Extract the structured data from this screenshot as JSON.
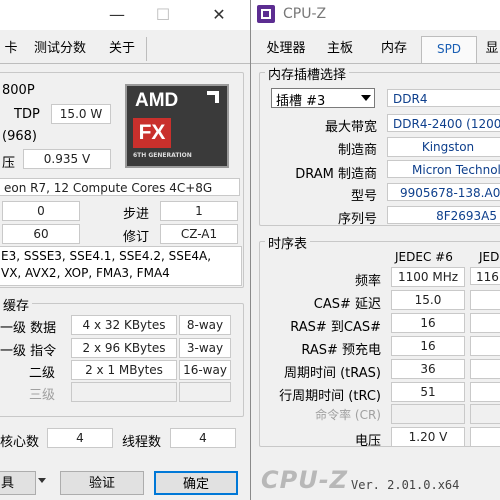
{
  "left": {
    "title_buttons": {
      "minimize": "—",
      "maximize": "☐",
      "close": "✕"
    },
    "tabs": [
      "卡",
      "测试分数",
      "关于"
    ],
    "cpu": {
      "model_suffix": "800P",
      "tdp_label": "TDP",
      "tdp_value": "15.0 W",
      "package_value": "(968)",
      "voltage_label": "压",
      "voltage_value": "0.935 V",
      "spec": "eon R7, 12 Compute Cores 4C+8G",
      "row1_left": "0",
      "stepping_label": "步进",
      "stepping_value": "1",
      "row2_left": "60",
      "revision_label": "修订",
      "revision_value": "CZ-A1",
      "instructions_line1": "E3, SSSE3, SSE4.1, SSE4.2, SSE4A,",
      "instructions_line2": "VX, AVX2, XOP, FMA3, FMA4"
    },
    "logo": {
      "brand": "AMD",
      "fx": "FX",
      "generation": "6TH GENERATION"
    },
    "cache": {
      "title": "缓存",
      "rows": [
        {
          "label": "一级 数据",
          "size": "4 x 32 KBytes",
          "way": "8-way"
        },
        {
          "label": "一级 指令",
          "size": "2 x 96 KBytes",
          "way": "3-way"
        },
        {
          "label": "二级",
          "size": "2 x 1 MBytes",
          "way": "16-way"
        },
        {
          "label": "三级",
          "size": "",
          "way": ""
        }
      ]
    },
    "cores_label": "核心数",
    "cores_value": "4",
    "threads_label": "线程数",
    "threads_value": "4",
    "tools_label": "具",
    "validate_label": "验证",
    "ok_label": "确定"
  },
  "right": {
    "app_title": "CPU-Z",
    "tabs": [
      "处理器",
      "主板",
      "内存",
      "SPD",
      "显"
    ],
    "slot_group_title": "内存插槽选择",
    "slot_select": "插槽 #3",
    "mem_type": "DDR4",
    "fields": [
      {
        "label": "最大带宽",
        "value": "DDR4-2400 (1200"
      },
      {
        "label": "制造商",
        "value": "Kingston"
      },
      {
        "label": "DRAM 制造商",
        "value": "Micron Technol"
      },
      {
        "label": "型号",
        "value": "9905678-138.A0"
      },
      {
        "label": "序列号",
        "value": "8F2693A5"
      }
    ],
    "timing_group_title": "时序表",
    "timing_headers": [
      "JEDEC #6",
      "JED"
    ],
    "timings": [
      {
        "label": "频率",
        "c1": "1100 MHz",
        "c2": "116"
      },
      {
        "label": "CAS# 延迟",
        "c1": "15.0",
        "c2": "1"
      },
      {
        "label": "RAS# 到CAS#",
        "c1": "16",
        "c2": ""
      },
      {
        "label": "RAS# 预充电",
        "c1": "16",
        "c2": ""
      },
      {
        "label": "周期时间 (tRAS)",
        "c1": "36",
        "c2": ""
      },
      {
        "label": "行周期时间 (tRC)",
        "c1": "51",
        "c2": ""
      },
      {
        "label": "命令率 (CR)",
        "c1": "",
        "c2": ""
      },
      {
        "label": "电压",
        "c1": "1.20 V",
        "c2": "1."
      }
    ],
    "footer_logo": "CPU-Z",
    "version": "Ver. 2.01.0.x64"
  }
}
